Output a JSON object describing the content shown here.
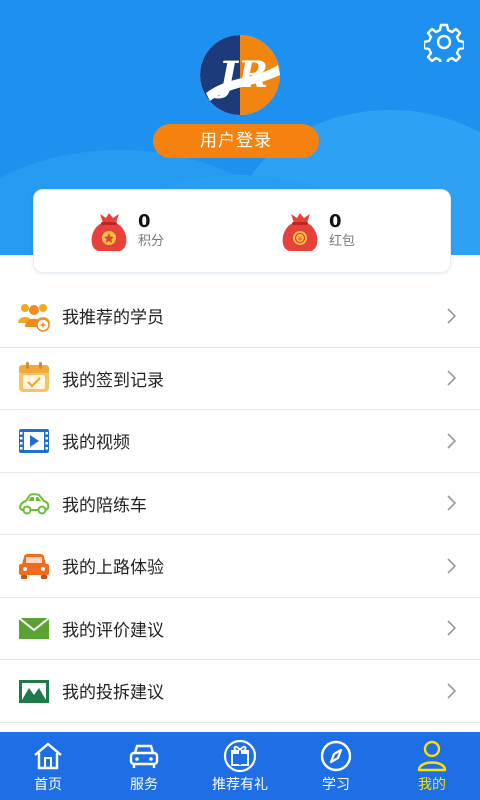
{
  "header": {
    "login_label": "用户登录",
    "settings_icon": "gear-icon",
    "logo_text": "JR"
  },
  "stats": [
    {
      "value": "0",
      "label": "积分",
      "icon": "money-bag-star-icon"
    },
    {
      "value": "0",
      "label": "红包",
      "icon": "money-bag-coin-icon"
    }
  ],
  "menu": [
    {
      "label": "我推荐的学员",
      "icon": "users-icon"
    },
    {
      "label": "我的签到记录",
      "icon": "calendar-check-icon"
    },
    {
      "label": "我的视频",
      "icon": "video-icon"
    },
    {
      "label": "我的陪练车",
      "icon": "car-outline-icon"
    },
    {
      "label": "我的上路体验",
      "icon": "car-icon"
    },
    {
      "label": "我的评价建议",
      "icon": "mail-icon"
    },
    {
      "label": "我的投拆建议",
      "icon": "mountain-mail-icon"
    }
  ],
  "tabs": [
    {
      "label": "首页",
      "icon": "home-icon",
      "active": false
    },
    {
      "label": "服务",
      "icon": "car-front-icon",
      "active": false
    },
    {
      "label": "推荐有礼",
      "icon": "gift-icon",
      "active": false
    },
    {
      "label": "学习",
      "icon": "compass-icon",
      "active": false
    },
    {
      "label": "我的",
      "icon": "user-icon",
      "active": true
    }
  ],
  "colors": {
    "header_blue": "#1e90f0",
    "tabbar_blue": "#1e6fe6",
    "accent_orange": "#f5820f",
    "active_tab": "#ffe100"
  }
}
